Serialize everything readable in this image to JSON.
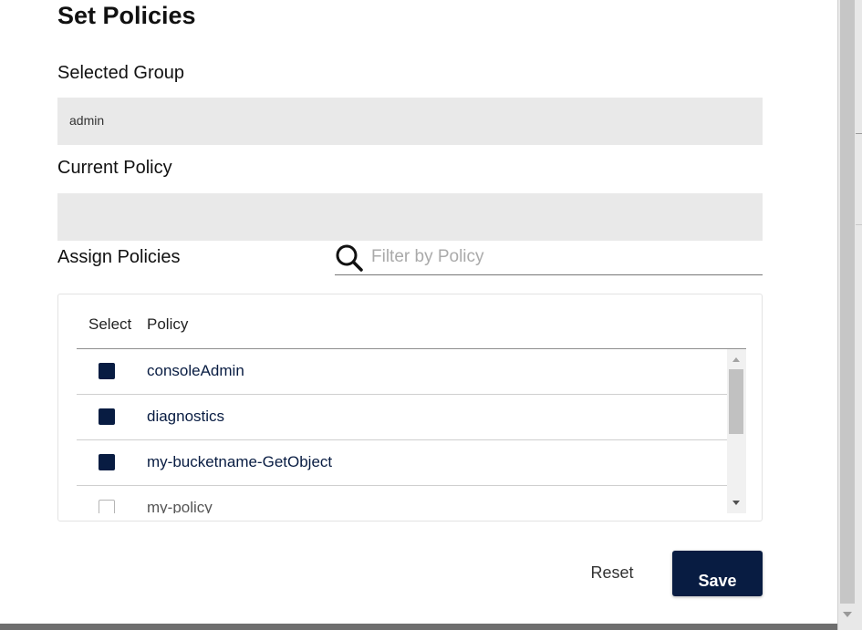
{
  "dialog": {
    "title": "Set Policies",
    "selected_group_label": "Selected Group",
    "selected_group_value": "admin",
    "current_policy_label": "Current Policy",
    "current_policy_value": "",
    "assign_policies_label": "Assign Policies"
  },
  "search": {
    "placeholder": "Filter by Policy",
    "value": "",
    "icon": "search-icon"
  },
  "table": {
    "headers": {
      "select": "Select",
      "policy": "Policy"
    },
    "rows": [
      {
        "label": "consoleAdmin",
        "checked": true
      },
      {
        "label": "diagnostics",
        "checked": true
      },
      {
        "label": "my-bucketname-GetObject",
        "checked": true
      },
      {
        "label": "my-policy",
        "checked": false
      }
    ]
  },
  "actions": {
    "reset_label": "Reset",
    "save_label": "Save"
  },
  "colors": {
    "accent": "#081c42",
    "field_background": "#e9e9e9"
  }
}
